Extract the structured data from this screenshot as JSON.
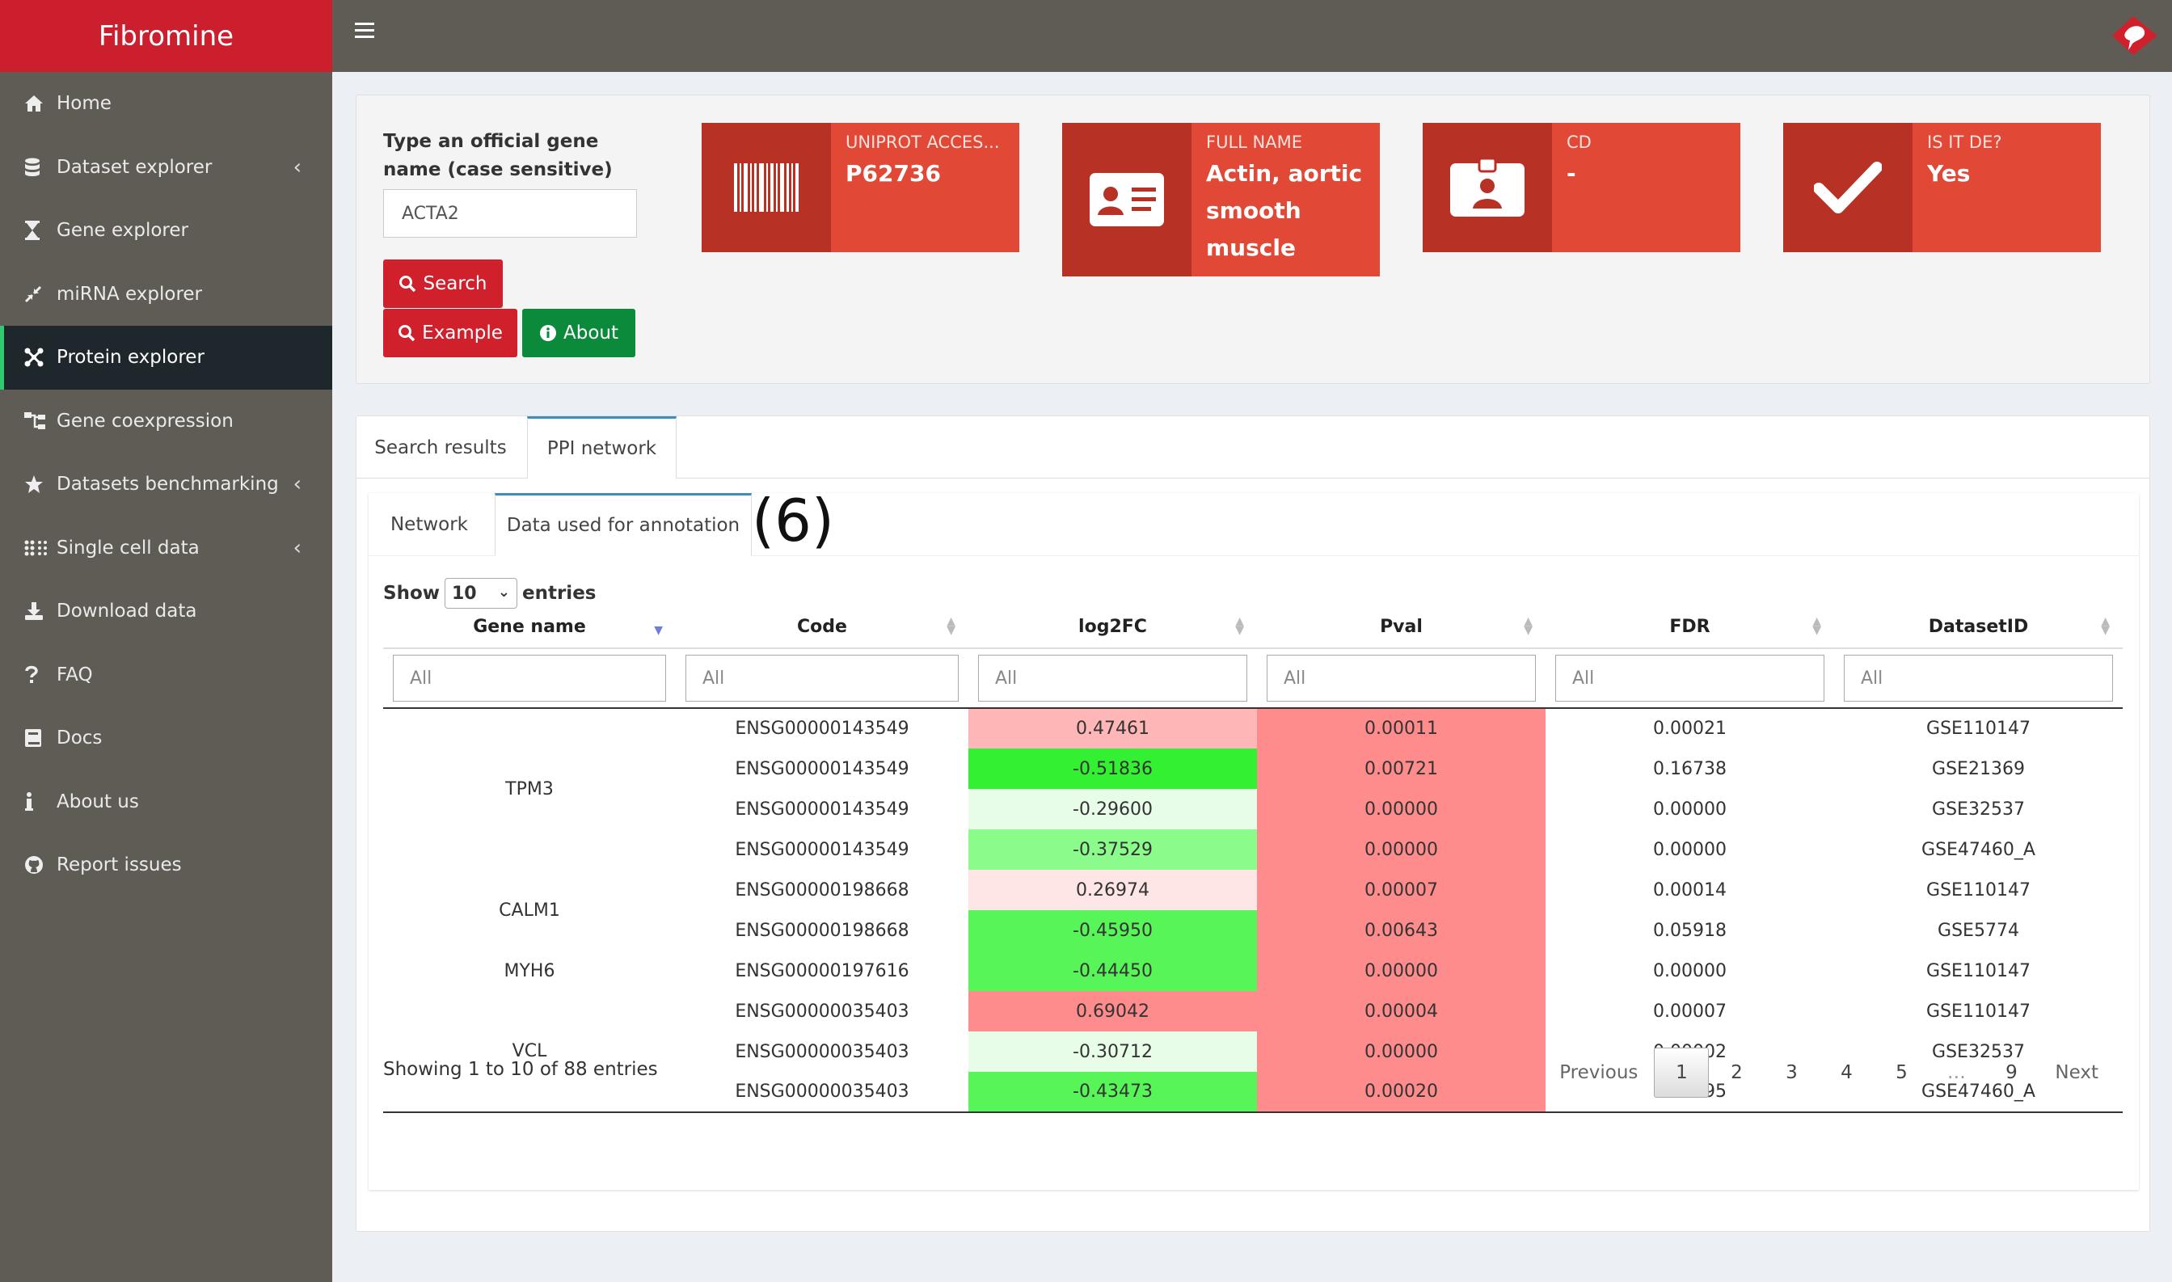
{
  "app": {
    "title": "Fibromine"
  },
  "sidebar": {
    "items": [
      {
        "label": "Home",
        "icon": "home-icon",
        "chevron": false
      },
      {
        "label": "Dataset explorer",
        "icon": "database-icon",
        "chevron": true
      },
      {
        "label": "Gene explorer",
        "icon": "hourglass-icon",
        "chevron": false
      },
      {
        "label": "miRNA explorer",
        "icon": "compress-icon",
        "chevron": false
      },
      {
        "label": "Protein explorer",
        "icon": "network-icon",
        "chevron": false,
        "active": true
      },
      {
        "label": "Gene coexpression",
        "icon": "sitemap-icon",
        "chevron": false
      },
      {
        "label": "Datasets benchmarking",
        "icon": "star-icon",
        "chevron": true
      },
      {
        "label": "Single cell data",
        "icon": "dots-grid-icon",
        "chevron": true
      },
      {
        "label": "Download data",
        "icon": "download-icon",
        "chevron": false
      },
      {
        "label": "FAQ",
        "icon": "question-icon",
        "chevron": false
      },
      {
        "label": "Docs",
        "icon": "book-icon",
        "chevron": false
      },
      {
        "label": "About us",
        "icon": "info-icon",
        "chevron": false
      },
      {
        "label": "Report issues",
        "icon": "github-icon",
        "chevron": false
      }
    ]
  },
  "search": {
    "label": "Type an official gene name (case sensitive)",
    "value": "ACTA2",
    "search_label": "Search",
    "example_label": "Example",
    "about_label": "About"
  },
  "infoboxes": [
    {
      "label": "UNIPROT ACCES...",
      "value": "P62736",
      "icon": "barcode-icon"
    },
    {
      "label": "FULL NAME",
      "value": "Actin, aortic smooth muscle",
      "icon": "id-card-icon"
    },
    {
      "label": "CD",
      "value": "-",
      "icon": "id-badge-icon"
    },
    {
      "label": "IS IT DE?",
      "value": "Yes",
      "icon": "check-icon"
    }
  ],
  "tabs": {
    "main": [
      "Search results",
      "PPI network"
    ],
    "sub": [
      "Network",
      "Data used for annotation"
    ]
  },
  "annotation": "(6)",
  "table": {
    "show_label": "Show",
    "entries_label": "entries",
    "page_size": "10",
    "columns": [
      "Gene name",
      "Code",
      "log2FC",
      "Pval",
      "FDR",
      "DatasetID"
    ],
    "filter_placeholder": "All",
    "colors": {
      "pval": "#ff8c8c"
    },
    "rows": [
      {
        "code": "ENSG00000143549",
        "log2fc": "0.47461",
        "pval": "0.00011",
        "fdr": "0.00021",
        "dataset": "GSE110147",
        "fc_color": "#ffb6b6"
      },
      {
        "code": "ENSG00000143549",
        "log2fc": "-0.51836",
        "pval": "0.00721",
        "fdr": "0.16738",
        "dataset": "GSE21369",
        "fc_color": "#33f033"
      },
      {
        "code": "ENSG00000143549",
        "log2fc": "-0.29600",
        "pval": "0.00000",
        "fdr": "0.00000",
        "dataset": "GSE32537",
        "fc_color": "#e8fde8"
      },
      {
        "code": "ENSG00000143549",
        "log2fc": "-0.37529",
        "pval": "0.00000",
        "fdr": "0.00000",
        "dataset": "GSE47460_A",
        "fc_color": "#8bfc8b"
      },
      {
        "code": "ENSG00000198668",
        "log2fc": "0.26974",
        "pval": "0.00007",
        "fdr": "0.00014",
        "dataset": "GSE110147",
        "fc_color": "#ffe6e6"
      },
      {
        "code": "ENSG00000198668",
        "log2fc": "-0.45950",
        "pval": "0.00643",
        "fdr": "0.05918",
        "dataset": "GSE5774",
        "fc_color": "#58f558"
      },
      {
        "code": "ENSG00000197616",
        "log2fc": "-0.44450",
        "pval": "0.00000",
        "fdr": "0.00000",
        "dataset": "GSE110147",
        "fc_color": "#58f558"
      },
      {
        "code": "ENSG00000035403",
        "log2fc": "0.69042",
        "pval": "0.00004",
        "fdr": "0.00007",
        "dataset": "GSE110147",
        "fc_color": "#ff8c8c"
      },
      {
        "code": "ENSG00000035403",
        "log2fc": "-0.30712",
        "pval": "0.00000",
        "fdr": "0.00002",
        "dataset": "GSE32537",
        "fc_color": "#e8fde8"
      },
      {
        "code": "ENSG00000035403",
        "log2fc": "-0.43473",
        "pval": "0.00020",
        "fdr": "0.00095",
        "dataset": "GSE47460_A",
        "fc_color": "#58f558"
      }
    ],
    "gene_groups": [
      {
        "name": "TPM3",
        "span": 4
      },
      {
        "name": "CALM1",
        "span": 2
      },
      {
        "name": "MYH6",
        "span": 1
      },
      {
        "name": "VCL",
        "span": 3
      }
    ],
    "info": "Showing 1 to 10 of 88 entries",
    "pagination": [
      "Previous",
      "1",
      "2",
      "3",
      "4",
      "5",
      "…",
      "9",
      "Next"
    ],
    "current_page": "1"
  }
}
